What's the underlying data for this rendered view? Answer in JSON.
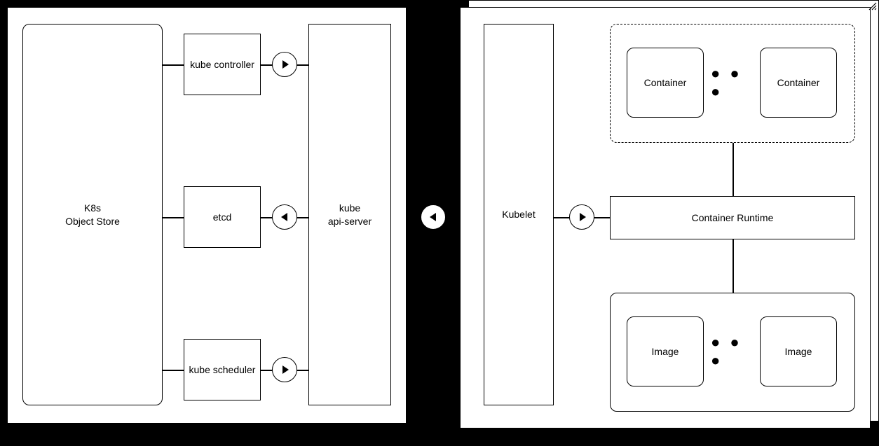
{
  "left": {
    "object_store": "K8s\nObject Store",
    "controller": "kube controller",
    "etcd": "etcd",
    "scheduler": "kube scheduler",
    "api_server": "kube\napi-server"
  },
  "right": {
    "kubelet": "Kubelet",
    "runtime": "Container Runtime",
    "container": "Container",
    "image": "Image"
  },
  "ellipsis": "● ● ●"
}
